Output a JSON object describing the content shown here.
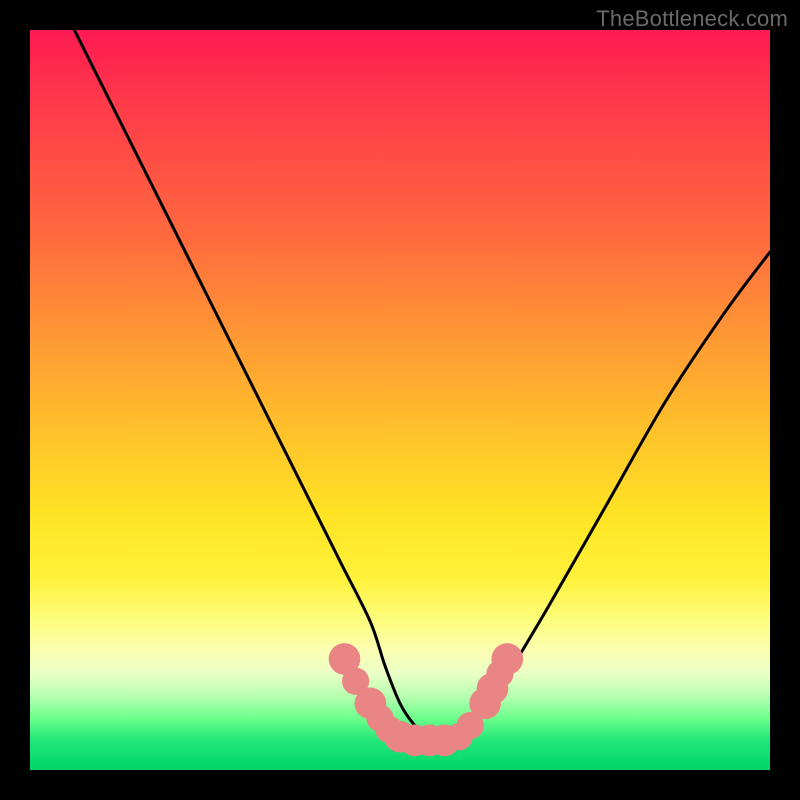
{
  "watermark": "TheBottleneck.com",
  "chart_data": {
    "type": "line",
    "title": "",
    "xlabel": "",
    "ylabel": "",
    "xlim": [
      0,
      100
    ],
    "ylim": [
      0,
      100
    ],
    "background_gradient_meaning": "bottleneck severity (green=none, red=severe)",
    "series": [
      {
        "name": "bottleneck-curve",
        "x": [
          6,
          10,
          14,
          18,
          22,
          26,
          30,
          34,
          38,
          42,
          46,
          48,
          50,
          52,
          54,
          56,
          58,
          60,
          64,
          70,
          78,
          86,
          94,
          100
        ],
        "values": [
          100,
          92,
          84,
          76,
          68,
          60,
          52,
          44,
          36,
          28,
          20,
          14,
          9,
          6,
          4,
          4,
          4,
          6,
          12,
          22,
          36,
          50,
          62,
          70
        ]
      }
    ],
    "markers": {
      "name": "highlighted-region",
      "color": "#e98584",
      "points": [
        {
          "x": 42.5,
          "y": 15.0,
          "r": 1.6
        },
        {
          "x": 44.0,
          "y": 12.0,
          "r": 1.3
        },
        {
          "x": 46.0,
          "y": 9.0,
          "r": 1.6
        },
        {
          "x": 47.3,
          "y": 7.0,
          "r": 1.3
        },
        {
          "x": 48.5,
          "y": 5.5,
          "r": 1.3
        },
        {
          "x": 50.0,
          "y": 4.5,
          "r": 1.6
        },
        {
          "x": 52.0,
          "y": 4.0,
          "r": 1.6
        },
        {
          "x": 54.0,
          "y": 4.0,
          "r": 1.6
        },
        {
          "x": 56.0,
          "y": 4.0,
          "r": 1.6
        },
        {
          "x": 58.0,
          "y": 4.5,
          "r": 1.3
        },
        {
          "x": 59.5,
          "y": 6.0,
          "r": 1.3
        },
        {
          "x": 61.5,
          "y": 9.0,
          "r": 1.6
        },
        {
          "x": 62.5,
          "y": 11.0,
          "r": 1.6
        },
        {
          "x": 63.5,
          "y": 13.0,
          "r": 1.3
        },
        {
          "x": 64.5,
          "y": 15.0,
          "r": 1.6
        }
      ]
    }
  }
}
